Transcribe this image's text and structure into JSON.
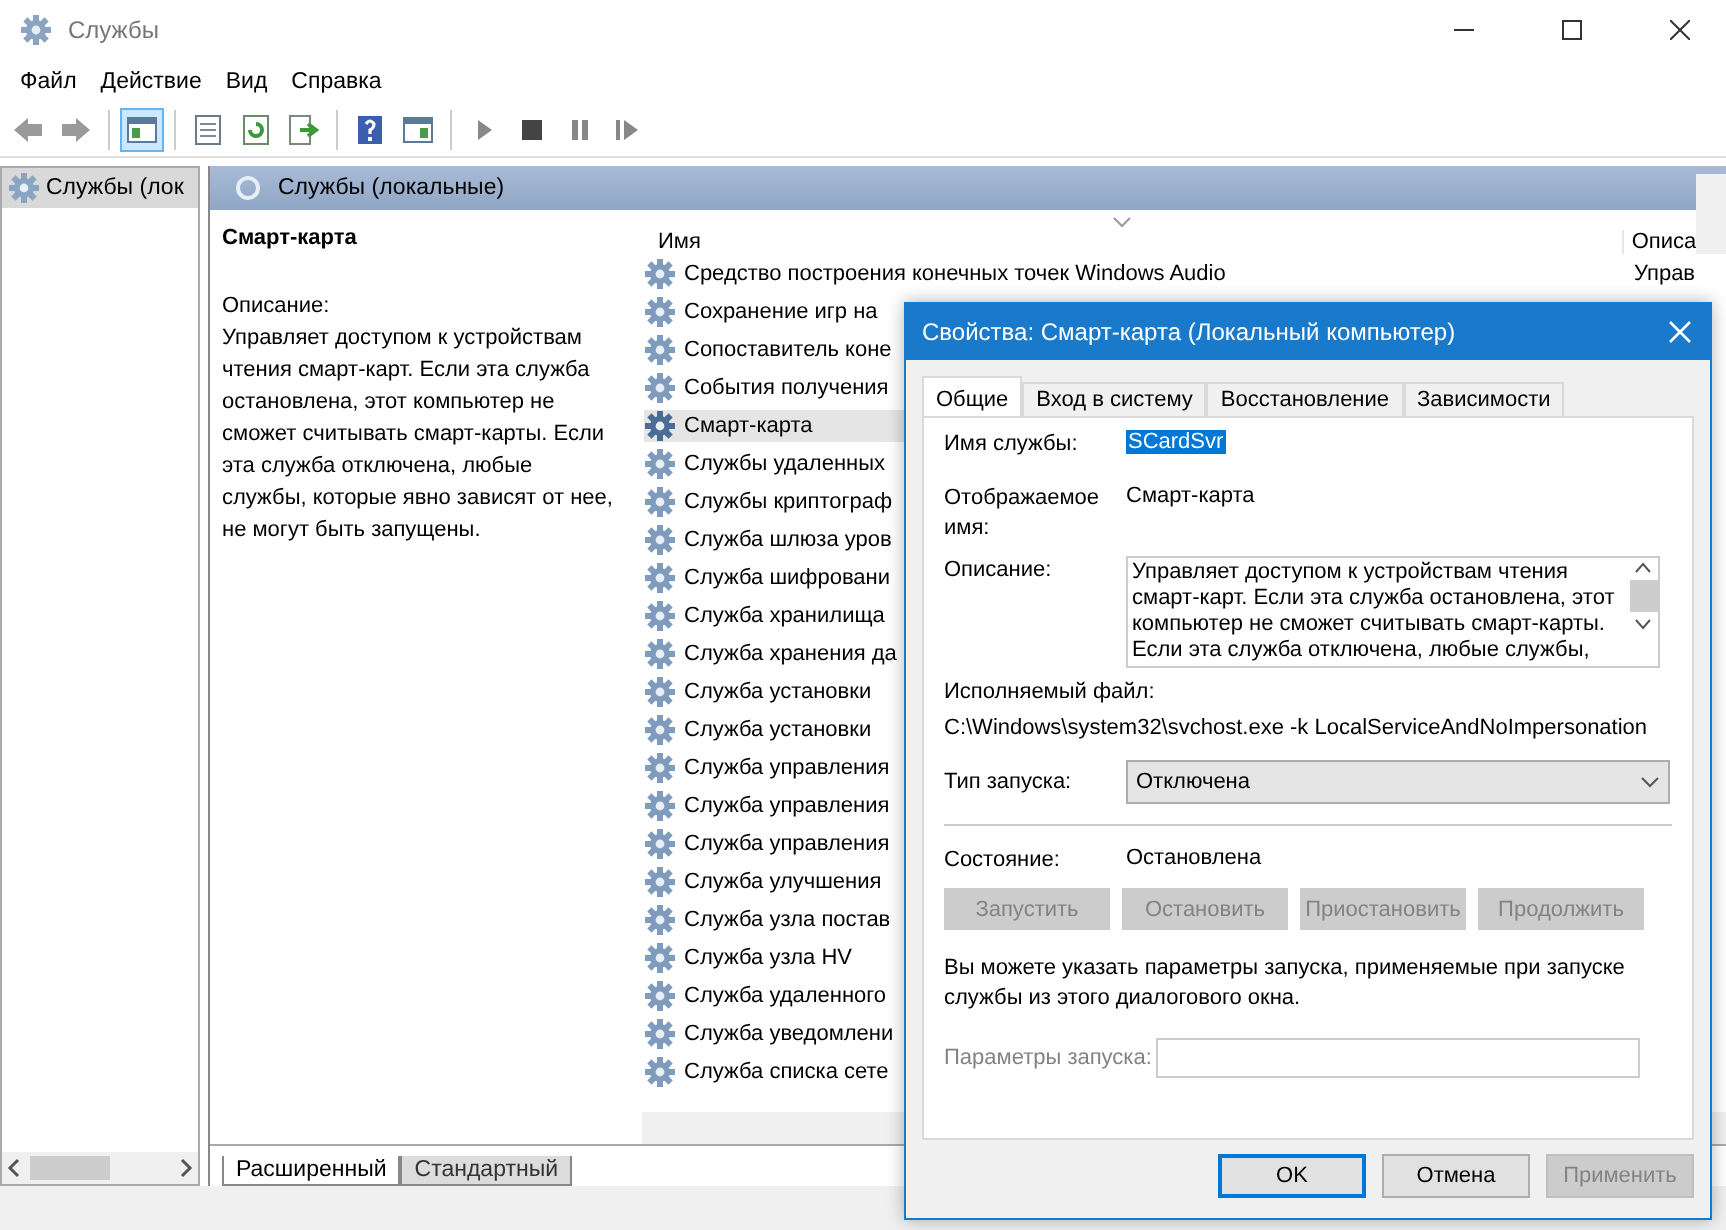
{
  "window": {
    "title": "Службы"
  },
  "menu": [
    "Файл",
    "Действие",
    "Вид",
    "Справка"
  ],
  "toolbar": [
    [
      {
        "kind": "back",
        "pressed": false
      },
      {
        "kind": "forward",
        "pressed": false
      }
    ],
    [
      {
        "kind": "console-tree",
        "pressed": true
      }
    ],
    [
      {
        "kind": "properties",
        "pressed": false
      },
      {
        "kind": "refresh",
        "pressed": false
      },
      {
        "kind": "export",
        "pressed": false
      }
    ],
    [
      {
        "kind": "help",
        "pressed": false
      },
      {
        "kind": "action-pane",
        "pressed": false
      }
    ],
    [
      {
        "kind": "play",
        "pressed": false
      },
      {
        "kind": "stop",
        "pressed": false
      },
      {
        "kind": "pause",
        "pressed": false
      },
      {
        "kind": "resume",
        "pressed": false
      }
    ]
  ],
  "tree": [
    {
      "label": "Службы (лок",
      "selected": true
    }
  ],
  "pane_header": "Службы (локальные)",
  "details": {
    "title": "Смарт-карта",
    "description_label": "Описание:",
    "description": "Управляет доступом к устройствам чтения смарт-карт. Если эта служба остановлена, этот компьютер не сможет считывать смарт-карты. Если эта служба отключена, любые службы, которые явно зависят от нее, не могут быть запущены."
  },
  "table": {
    "columns": [
      "Имя",
      "Описа"
    ],
    "rows": [
      {
        "name": "Средство построения конечных точек Windows Audio",
        "column_2": "Управ",
        "selected": false
      },
      {
        "name": "Сохранение игр на",
        "selected": false
      },
      {
        "name": "Сопоставитель коне",
        "selected": false
      },
      {
        "name": "События получения",
        "selected": false
      },
      {
        "name": "Смарт-карта",
        "selected": true
      },
      {
        "name": "Службы удаленных",
        "selected": false
      },
      {
        "name": "Службы криптограф",
        "selected": false
      },
      {
        "name": "Служба шлюза уров",
        "selected": false
      },
      {
        "name": "Служба шифровани",
        "selected": false
      },
      {
        "name": "Служба хранилища",
        "selected": false
      },
      {
        "name": "Служба хранения да",
        "selected": false
      },
      {
        "name": "Служба установки",
        "selected": false
      },
      {
        "name": "Служба установки",
        "selected": false
      },
      {
        "name": "Служба управления",
        "selected": false
      },
      {
        "name": "Служба управления",
        "selected": false
      },
      {
        "name": "Служба управления",
        "selected": false
      },
      {
        "name": "Служба улучшения",
        "selected": false
      },
      {
        "name": "Служба узла постав",
        "selected": false
      },
      {
        "name": "Служба узла HV",
        "selected": false
      },
      {
        "name": "Служба удаленного",
        "selected": false
      },
      {
        "name": "Служба уведомлени",
        "selected": false
      },
      {
        "name": "Служба списка сете",
        "selected": false
      }
    ]
  },
  "view_tabs": [
    {
      "label": "Расширенный",
      "selected": true
    },
    {
      "label": "Стандартный",
      "selected": false
    }
  ],
  "dialog": {
    "title": "Свойства: Смарт-карта (Локальный компьютер)",
    "tabs": [
      {
        "label": "Общие",
        "selected": true
      },
      {
        "label": "Вход в систему",
        "selected": false
      },
      {
        "label": "Восстановление",
        "selected": false
      },
      {
        "label": "Зависимости",
        "selected": false
      }
    ],
    "service_name_label": "Имя службы:",
    "service_name": {
      "text": "SCardSvr",
      "highlighted": true
    },
    "display_name_label": "Отображаемое имя:",
    "display_name": "Смарт-карта",
    "description_label": "Описание:",
    "description": "Управляет доступом к устройствам чтения смарт-карт. Если эта служба остановлена, этот компьютер не сможет считывать смарт-карты. Если эта служба отключена, любые службы,",
    "executable_label": "Исполняемый файл:",
    "executable": "C:\\Windows\\system32\\svchost.exe -k LocalServiceAndNoImpersonation",
    "startup_type_label": "Тип запуска:",
    "startup_type": "Отключена",
    "status_label": "Состояние:",
    "status_value": "Остановлена",
    "service_buttons": [
      {
        "label": "Запустить",
        "disabled": true
      },
      {
        "label": "Остановить",
        "disabled": true
      },
      {
        "label": "Приостановить",
        "disabled": true
      },
      {
        "label": "Продолжить",
        "disabled": true
      }
    ],
    "hint": "Вы можете указать параметры запуска, применяемые при запуске службы из этого диалогового окна.",
    "params": {
      "label": "Параметры запуска:",
      "disabled": true
    },
    "buttons": [
      {
        "label": "OK",
        "default": true,
        "disabled": false
      },
      {
        "label": "Отмена",
        "default": false,
        "disabled": false
      },
      {
        "label": "Применить",
        "default": false,
        "disabled": true
      }
    ]
  }
}
